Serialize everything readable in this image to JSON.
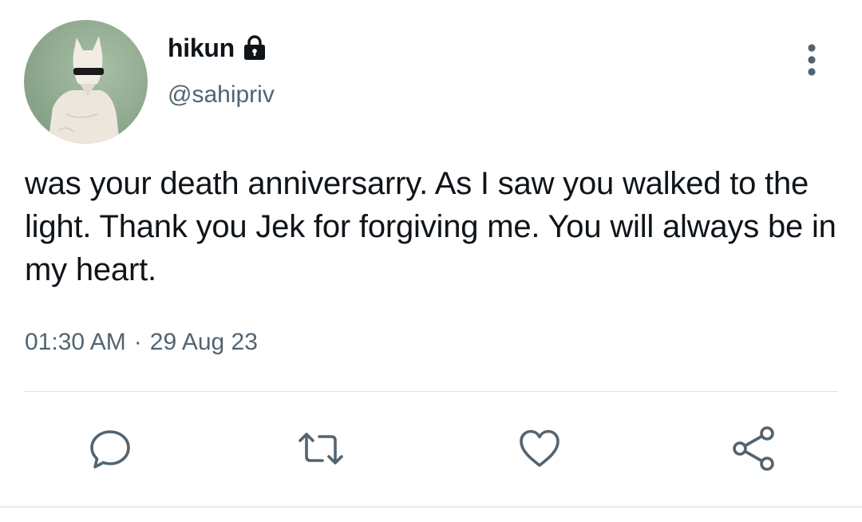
{
  "tweet": {
    "author": {
      "display_name": "hikun",
      "handle": "@sahipriv",
      "protected_icon": "lock-icon",
      "avatar_icon": "avatar"
    },
    "text": "was your death anniversarry. As I saw you walked to the light. Thank you Jek for forgiving me. You will always be in my heart.",
    "time": "01:30 AM",
    "separator": "·",
    "date": "29 Aug 23",
    "more_icon": "more-vertical-icon",
    "actions": [
      {
        "name": "reply",
        "icon": "reply-icon"
      },
      {
        "name": "retweet",
        "icon": "retweet-icon"
      },
      {
        "name": "like",
        "icon": "heart-icon"
      },
      {
        "name": "share",
        "icon": "share-icon"
      }
    ]
  },
  "colors": {
    "text_primary": "#0f1419",
    "text_secondary": "#536471",
    "icon_gray": "#536471",
    "divider": "#dfe3e6"
  }
}
